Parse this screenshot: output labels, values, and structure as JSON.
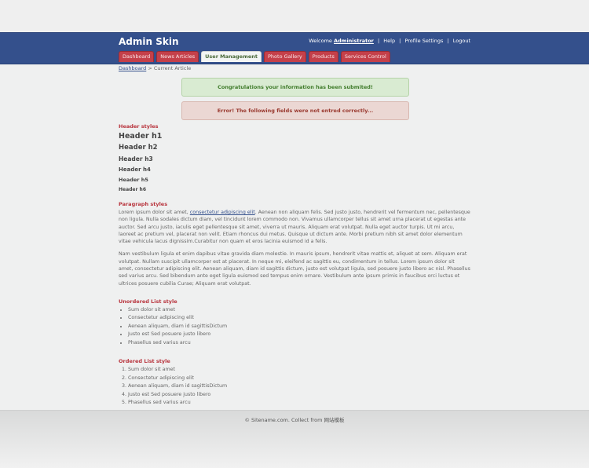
{
  "header": {
    "brand": "Admin Skin",
    "welcome_text": "Welcome",
    "user_name": "Administrator",
    "help_link": "Help",
    "profile_link": "Profile Settings",
    "logout_link": "Logout",
    "separator": "|"
  },
  "tabs": [
    {
      "label": "Dashboard",
      "active": false
    },
    {
      "label": "News Articles",
      "active": false
    },
    {
      "label": "User Management",
      "active": true
    },
    {
      "label": "Photo Gallery",
      "active": false
    },
    {
      "label": "Products",
      "active": false
    },
    {
      "label": "Services Control",
      "active": false
    }
  ],
  "breadcrumb": {
    "home_link": "Dashboard",
    "separator": ">",
    "current": "Current Article"
  },
  "messages": {
    "success": "Congratulations your information has been submited!",
    "error": "Error! The following fields were not entred correctly..."
  },
  "headers_section": {
    "title": "Header styles",
    "h1": "Header h1",
    "h2": "Header h2",
    "h3": "Header h3",
    "h4": "Header h4",
    "h5": "Header h5",
    "h6": "Header h6"
  },
  "paragraph_section": {
    "title": "Paragraph styles",
    "p1_before_link": "Lorem ipsum dolor sit amet,",
    "p1_link": "consectetur adipiscing elit",
    "p1_after_link": ". Aenean non aliquam felis. Sed justo justo, hendrerit vel fermentum nec, pellentesque non ligula. Nulla sodales dictum diam, vel tincidunt lorem commodo non. Vivamus ullamcorper tellus sit amet urna placerat ut egestas ante auctor. Sed arcu justo, iaculis eget pellentesque sit amet, viverra ut mauris. Aliquam erat volutpat. Nulla eget auctor turpis. Ut mi arcu, laoreet ac pretium vel, placerat non velit. Etiam rhoncus dui metus. Quisque ut dictum ante. Morbi pretium nibh sit amet dolor elementum vitae vehicula lacus dignissim.Curabitur non quam et eros lacinia euismod id a felis.",
    "p2": "Nam vestibulum ligula et enim dapibus vitae gravida diam molestie. In mauris ipsum, hendrerit vitae mattis et, aliquet at sem. Aliquam erat volutpat. Nullam suscipit ullamcorper est at placerat. In neque mi, eleifend ac sagittis eu, condimentum in tellus. Lorem ipsum dolor sit amet, consectetur adipiscing elit. Aenean aliquam, diam id sagittis dictum, justo est volutpat ligula, sed posuere justo libero ac nisl. Phasellus sed varius arcu. Sed bibendum ante eget ligula euismod sed tempus enim ornare. Vestibulum ante ipsum primis in faucibus orci luctus et ultrices posuere cubilia Curae; Aliquam erat volutpat."
  },
  "unordered_section": {
    "title": "Unordered List style",
    "items": [
      "Sum dolor sit amet",
      "Consectetur adipiscing elit",
      "Aenean aliquam, diam id sagittisDictum",
      "Justo est Sed posuere justo libero",
      "Phasellus sed varius arcu"
    ]
  },
  "ordered_section": {
    "title": "Ordered List style",
    "items": [
      "Sum dolor sit amet",
      "Consectetur adipiscing elit",
      "Aenean aliquam, diam id sagittisDictum",
      "Justo est Sed posuere justo libero",
      "Phasellus sed varius arcu"
    ]
  },
  "footer": {
    "text": "© Sitename.com. Collect from 网站模板"
  },
  "colors": {
    "header_bg": "#34508c",
    "tab_bg": "#c4404a",
    "accent_red": "#b8343d",
    "success_text": "#3f7b2a",
    "error_text": "#9a3a30"
  }
}
